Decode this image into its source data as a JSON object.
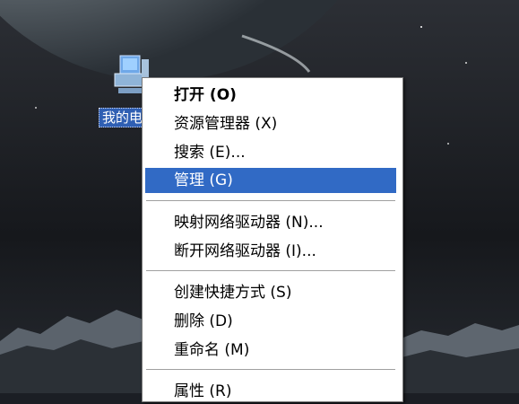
{
  "desktop": {
    "icon_label": "我的电脑"
  },
  "context_menu": {
    "items": [
      {
        "label": "打开 (O)"
      },
      {
        "label": "资源管理器 (X)"
      },
      {
        "label": "搜索 (E)..."
      },
      {
        "label": "管理 (G)"
      },
      {
        "label": "映射网络驱动器 (N)..."
      },
      {
        "label": "断开网络驱动器 (I)..."
      },
      {
        "label": "创建快捷方式 (S)"
      },
      {
        "label": "删除 (D)"
      },
      {
        "label": "重命名 (M)"
      },
      {
        "label": "属性 (R)"
      }
    ],
    "highlight_color": "#316ac5"
  }
}
